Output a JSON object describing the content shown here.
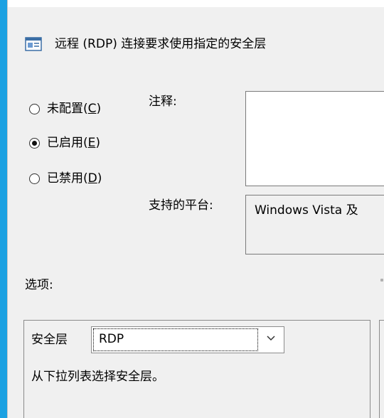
{
  "policy": {
    "title": "远程 (RDP) 连接要求使用指定的安全层"
  },
  "state_options": [
    {
      "prefix": "未配置(",
      "key": "C",
      "suffix": ")",
      "checked": false
    },
    {
      "prefix": "已启用(",
      "key": "E",
      "suffix": ")",
      "checked": true
    },
    {
      "prefix": "已禁用(",
      "key": "D",
      "suffix": ")",
      "checked": false
    }
  ],
  "comment": {
    "label": "注释:",
    "value": ""
  },
  "platform": {
    "label": "支持的平台:",
    "value": "Windows Vista 及"
  },
  "options": {
    "label": "选项:",
    "security_layer_label": "安全层",
    "security_layer_value": "RDP",
    "description": "从下拉列表选择安全层。"
  },
  "colors": {
    "window_accent": "#1ba1e2",
    "background": "#f0f0f0"
  },
  "icons": {
    "title": "policy-setting-icon",
    "dropdown": "chevron-down-icon"
  }
}
